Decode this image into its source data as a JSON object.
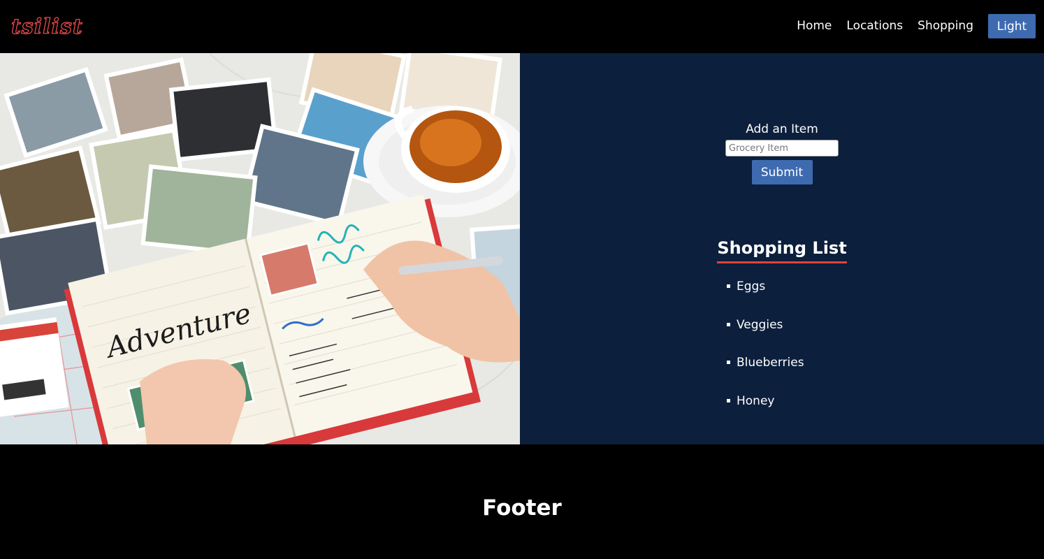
{
  "header": {
    "logo": "tsilist",
    "nav": [
      "Home",
      "Locations",
      "Shopping"
    ],
    "theme_button": "Light"
  },
  "form": {
    "label": "Add an Item",
    "input_placeholder": "Grocery Item",
    "submit": "Submit"
  },
  "shopping": {
    "heading": "Shopping List",
    "items": [
      "Eggs",
      "Veggies",
      "Blueberries",
      "Honey"
    ]
  },
  "footer": {
    "title": "Footer"
  },
  "hero": {
    "journal_text": "Adventure"
  },
  "colors": {
    "logo_red": "#e64b4b",
    "button_blue": "#3e6bb0",
    "panel_navy": "#0c1f3c",
    "underline_red": "#e0433a"
  }
}
